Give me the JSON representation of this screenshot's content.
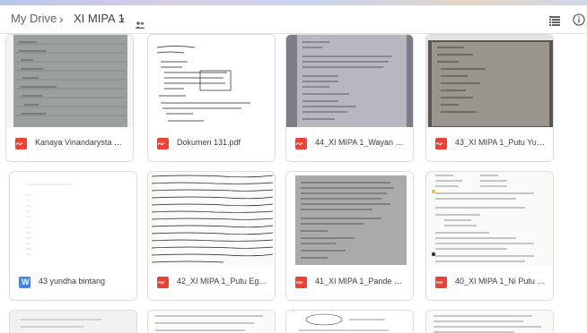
{
  "breadcrumb": {
    "root": "My Drive",
    "separator": "›",
    "current": "XI MIPA 1",
    "caret": "▾"
  },
  "icons": {
    "shared": "people-icon",
    "list_view": "list-view-icon",
    "info": "info-icon"
  },
  "files": [
    {
      "name": "Kanaya Vinandarysta Naz...",
      "type": "pdf"
    },
    {
      "name": "Dokumen 131.pdf",
      "type": "pdf"
    },
    {
      "name": "44_XI MIPA 1_Wayan Wa...",
      "type": "pdf"
    },
    {
      "name": "43_XI MIPA 1_Putu Yund...",
      "type": "pdf"
    },
    {
      "name": "43 yundha bintang",
      "type": "doc"
    },
    {
      "name": "42_XI MIPA 1_Putu Egni T...",
      "type": "pdf"
    },
    {
      "name": "41_XI MIPA 1_Pande Ged...",
      "type": "pdf"
    },
    {
      "name": "40_XI MIPA 1_Ni Putu Ka...",
      "type": "pdf"
    }
  ]
}
